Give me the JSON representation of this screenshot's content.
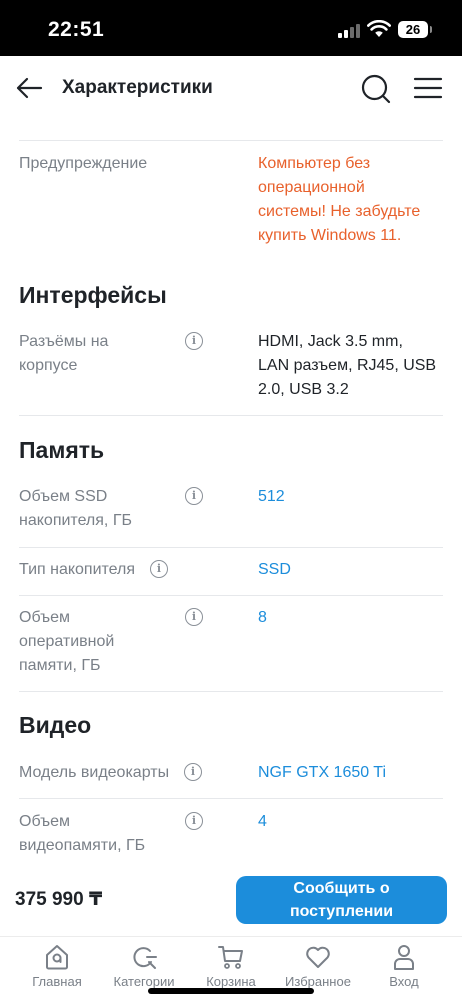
{
  "status_bar": {
    "time": "22:51",
    "battery": "26"
  },
  "header": {
    "title": "Характеристики"
  },
  "specs": {
    "warning": {
      "label": "Предупреждение",
      "value": [
        "Компьютер без",
        "операционной",
        "системы! Не забудьте",
        "купить Windows 11."
      ]
    },
    "interfaces": {
      "title": "Интерфейсы",
      "ports": {
        "label": [
          "Разъёмы на",
          "корпусе"
        ],
        "value": [
          "HDMI, Jack 3.5 mm,",
          "LAN разъем, RJ45, USB",
          "2.0, USB 3.2"
        ]
      }
    },
    "memory": {
      "title": "Память",
      "ssd_size": {
        "label": [
          "Объем SSD",
          "накопителя, ГБ"
        ],
        "value": "512"
      },
      "drive_type": {
        "label": "Тип накопителя",
        "value": "SSD"
      },
      "ram": {
        "label": [
          "Объем",
          "оперативной",
          "памяти, ГБ"
        ],
        "value": "8"
      }
    },
    "video": {
      "title": "Видео",
      "gpu_model": {
        "label": "Модель видеокарты",
        "value": "NGF GTX 1650 Ti"
      },
      "vram": {
        "label": [
          "Объем",
          "видеопамяти, ГБ"
        ],
        "value": "4"
      }
    }
  },
  "buy_bar": {
    "price": "375 990 ₸",
    "notify_button": [
      "Сообщить о",
      "поступлении"
    ]
  },
  "tab_bar": [
    {
      "label": "Главная"
    },
    {
      "label": "Категории"
    },
    {
      "label": "Корзина"
    },
    {
      "label": "Избранное"
    },
    {
      "label": "Вход"
    }
  ],
  "colors": {
    "accent": "#1c8ddb",
    "warning": "#e8612c",
    "label": "#7a8088",
    "text": "#1f2328"
  }
}
